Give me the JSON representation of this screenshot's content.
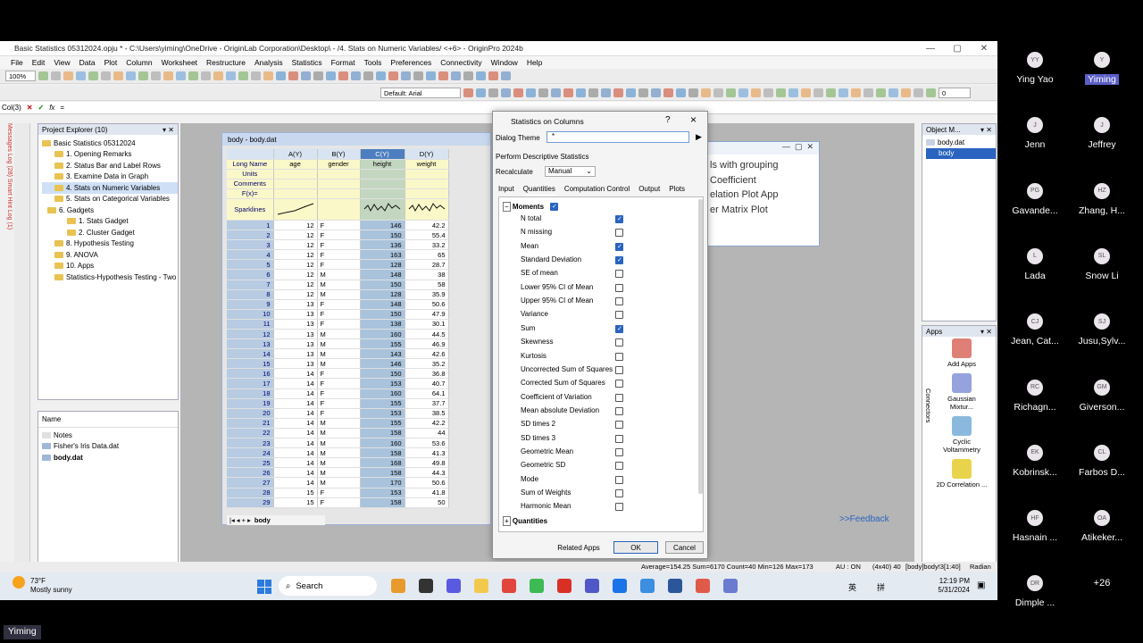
{
  "window": {
    "title": "Basic Statistics 05312024.opju * - C:\\Users\\yiming\\OneDrive - OriginLab Corporation\\Desktop\\ - /4. Stats on Numeric Variables/ <+6> - OriginPro 2024b"
  },
  "menu": [
    "File",
    "Edit",
    "View",
    "Data",
    "Plot",
    "Column",
    "Worksheet",
    "Restructure",
    "Analysis",
    "Statistics",
    "Format",
    "Tools",
    "Preferences",
    "Connectivity",
    "Window",
    "Help"
  ],
  "toolbar": {
    "zoom": "100%",
    "font": "Default: Arial",
    "size": "0",
    "size2": "0"
  },
  "formula": {
    "cell": "Col(3)",
    "fx": "fx",
    "eq": "="
  },
  "sidetabs": "Messages Log (28)   Smart Hint Log (1)",
  "project_explorer": {
    "title": "Project Explorer (10)",
    "root": "Basic Statistics 05312024",
    "folders": [
      "1. Opening Remarks",
      "2. Status Bar and Label Rows",
      "3. Examine Data in Graph",
      "4. Stats on Numeric Variables",
      "5. Stats on Categorical Variables",
      "6. Gadgets",
      "1. Stats Gadget",
      "2. Cluster Gadget",
      "8. Hypothesis Testing",
      "9. ANOVA",
      "10. Apps",
      "Statistics-Hypothesis Testing - Two"
    ],
    "files_header": "Name",
    "files": [
      "Notes",
      "Fisher's Iris Data.dat",
      "body.dat"
    ]
  },
  "workbook": {
    "title": "body - body.dat",
    "col_headers": [
      "A(Y)",
      "B(Y)",
      "C(Y)",
      "D(Y)"
    ],
    "row_labels": [
      "Long Name",
      "Units",
      "Comments",
      "F(x)=",
      "Sparklines"
    ],
    "long_names": [
      "age",
      "gender",
      "height",
      "weight"
    ],
    "sheet_tab": "body",
    "rows": [
      [
        "1",
        "12",
        "F",
        "146",
        "42.2"
      ],
      [
        "2",
        "12",
        "F",
        "150",
        "55.4"
      ],
      [
        "3",
        "12",
        "F",
        "136",
        "33.2"
      ],
      [
        "4",
        "12",
        "F",
        "163",
        "65"
      ],
      [
        "5",
        "12",
        "F",
        "128",
        "28.7"
      ],
      [
        "6",
        "12",
        "M",
        "148",
        "38"
      ],
      [
        "7",
        "12",
        "M",
        "150",
        "58"
      ],
      [
        "8",
        "12",
        "M",
        "128",
        "35.9"
      ],
      [
        "9",
        "13",
        "F",
        "148",
        "50.6"
      ],
      [
        "10",
        "13",
        "F",
        "150",
        "47.9"
      ],
      [
        "11",
        "13",
        "F",
        "138",
        "30.1"
      ],
      [
        "12",
        "13",
        "M",
        "160",
        "44.5"
      ],
      [
        "13",
        "13",
        "M",
        "155",
        "46.9"
      ],
      [
        "14",
        "13",
        "M",
        "143",
        "42.6"
      ],
      [
        "15",
        "13",
        "M",
        "146",
        "35.2"
      ],
      [
        "16",
        "14",
        "F",
        "150",
        "36.8"
      ],
      [
        "17",
        "14",
        "F",
        "153",
        "40.7"
      ],
      [
        "18",
        "14",
        "F",
        "160",
        "64.1"
      ],
      [
        "19",
        "14",
        "F",
        "155",
        "37.7"
      ],
      [
        "20",
        "14",
        "F",
        "153",
        "38.5"
      ],
      [
        "21",
        "14",
        "M",
        "155",
        "42.2"
      ],
      [
        "22",
        "14",
        "M",
        "158",
        "44"
      ],
      [
        "23",
        "14",
        "M",
        "160",
        "53.6"
      ],
      [
        "24",
        "14",
        "M",
        "158",
        "41.3"
      ],
      [
        "25",
        "14",
        "M",
        "168",
        "49.8"
      ],
      [
        "26",
        "14",
        "M",
        "158",
        "44.3"
      ],
      [
        "27",
        "14",
        "M",
        "170",
        "50.6"
      ],
      [
        "28",
        "15",
        "F",
        "153",
        "41.8"
      ],
      [
        "29",
        "15",
        "F",
        "158",
        "50"
      ]
    ]
  },
  "behind_window": {
    "lines": [
      "ls with grouping",
      "Coefficient",
      "elation Plot App",
      "er Matrix Plot"
    ]
  },
  "dialog": {
    "title": "Statistics on Columns",
    "help": "?",
    "close": "×",
    "theme_label": "Dialog Theme",
    "theme_value": "*",
    "section": "Perform Descriptive Statistics",
    "recalc_label": "Recalculate",
    "recalc_value": "Manual",
    "tabs": [
      "Input",
      "Quantities",
      "Computation Control",
      "Output",
      "Plots"
    ],
    "group": "Moments",
    "group2": "Quantities",
    "items": [
      {
        "label": "N total",
        "checked": true
      },
      {
        "label": "N missing",
        "checked": false
      },
      {
        "label": "Mean",
        "checked": true
      },
      {
        "label": "Standard Deviation",
        "checked": true
      },
      {
        "label": "SE of mean",
        "checked": false
      },
      {
        "label": "Lower 95% CI of Mean",
        "checked": false
      },
      {
        "label": "Upper 95% CI of Mean",
        "checked": false
      },
      {
        "label": "Variance",
        "checked": false
      },
      {
        "label": "Sum",
        "checked": true
      },
      {
        "label": "Skewness",
        "checked": false
      },
      {
        "label": "Kurtosis",
        "checked": false
      },
      {
        "label": "Uncorrected Sum of Squares",
        "checked": false
      },
      {
        "label": "Corrected Sum of Squares",
        "checked": false
      },
      {
        "label": "Coefficient of Variation",
        "checked": false
      },
      {
        "label": "Mean absolute Deviation",
        "checked": false
      },
      {
        "label": "SD times 2",
        "checked": false
      },
      {
        "label": "SD times 3",
        "checked": false
      },
      {
        "label": "Geometric Mean",
        "checked": false
      },
      {
        "label": "Geometric SD",
        "checked": false
      },
      {
        "label": "Mode",
        "checked": false
      },
      {
        "label": "Sum of Weights",
        "checked": false
      },
      {
        "label": "Harmonic Mean",
        "checked": false
      }
    ],
    "btn_related": "Related Apps",
    "btn_ok": "OK",
    "btn_cancel": "Cancel"
  },
  "object_manager": {
    "title": "Object M...",
    "items": [
      "body.dat",
      "body"
    ]
  },
  "apps": {
    "title": "Apps",
    "items": [
      "Add Apps",
      "Gaussian Mixtur...",
      "Cyclic Voltammetry",
      "2D Correlation ..."
    ],
    "side": "Connectors"
  },
  "feedback": ">>Feedback",
  "status": {
    "stats": "Average=154.25 Sum=6170 Count=40 Min=126 Max=173",
    "au": "AU : ON",
    "dims": "(4x40) 40",
    "ref": "[body]body!3[1:40]",
    "unit": "Radian"
  },
  "taskbar": {
    "weather_temp": "73°F",
    "weather_desc": "Mostly sunny",
    "search": "Search",
    "lang": "英",
    "ime": "拼",
    "time": "12:19 PM",
    "date": "5/31/2024"
  },
  "participants": [
    {
      "initials": "YY",
      "name": "Ying Yao"
    },
    {
      "initials": "Y",
      "name": "Yiming",
      "active": true
    },
    {
      "initials": "J",
      "name": "Jenn"
    },
    {
      "initials": "J",
      "name": "Jeffrey"
    },
    {
      "initials": "PG",
      "name": "Gavande..."
    },
    {
      "initials": "HZ",
      "name": "Zhang, H..."
    },
    {
      "initials": "L",
      "name": "Lada"
    },
    {
      "initials": "SL",
      "name": "Snow Li"
    },
    {
      "initials": "CJ",
      "name": "Jean, Cat..."
    },
    {
      "initials": "SJ",
      "name": "Jusu,Sylv..."
    },
    {
      "initials": "RC",
      "name": "Richagn..."
    },
    {
      "initials": "GM",
      "name": "Giverson..."
    },
    {
      "initials": "EK",
      "name": "Kobrinsk..."
    },
    {
      "initials": "CL",
      "name": "Farbos D..."
    },
    {
      "initials": "HF",
      "name": "Hasnain ..."
    },
    {
      "initials": "OA",
      "name": "Atikeker..."
    },
    {
      "initials": "DR",
      "name": "Dimple ..."
    },
    {
      "initials": "+26",
      "name": ""
    }
  ],
  "speaker_label": "Yiming",
  "colors": {
    "accent": "#2a64c0",
    "meet_bg": "#000000",
    "selected_col": "#a9c3dc"
  }
}
